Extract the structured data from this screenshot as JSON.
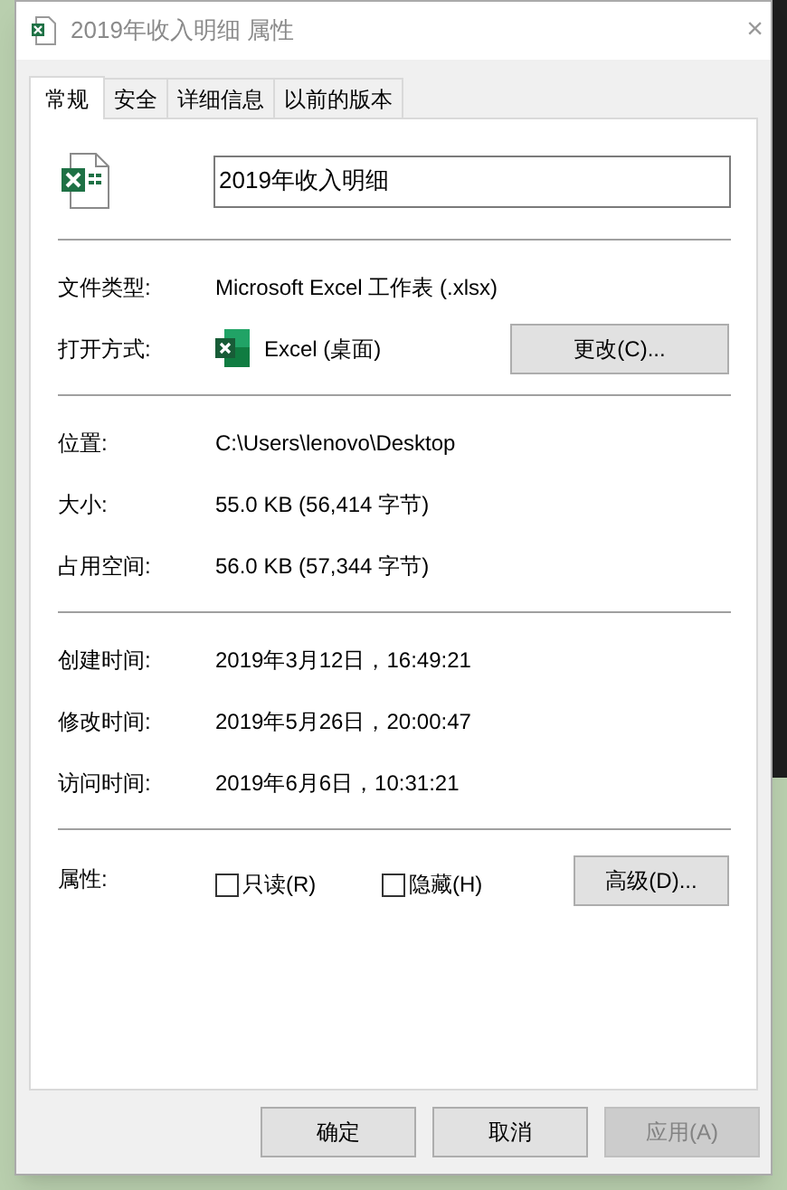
{
  "window": {
    "title": "2019年收入明细 属性",
    "close": "×"
  },
  "tabs": [
    {
      "label": "常规",
      "selected": true
    },
    {
      "label": "安全",
      "selected": false
    },
    {
      "label": "详细信息",
      "selected": false
    },
    {
      "label": "以前的版本",
      "selected": false
    }
  ],
  "file_name": {
    "value": "2019年收入明细"
  },
  "sections": [
    {
      "rows": [
        {
          "kind": "text",
          "label": "文件类型:",
          "value": "Microsoft Excel 工作表 (.xlsx)"
        },
        {
          "kind": "app",
          "label": "打开方式:",
          "value": "Excel (桌面)",
          "button": "更改(C)..."
        }
      ]
    },
    {
      "rows": [
        {
          "kind": "text",
          "label": "位置:",
          "value": "C:\\Users\\lenovo\\Desktop"
        },
        {
          "kind": "text",
          "label": "大小:",
          "value": "55.0 KB (56,414 字节)"
        },
        {
          "kind": "text",
          "label": "占用空间:",
          "value": "56.0 KB (57,344 字节)"
        }
      ]
    },
    {
      "rows": [
        {
          "kind": "text",
          "label": "创建时间:",
          "value": "2019年3月12日，16:49:21"
        },
        {
          "kind": "text",
          "label": "修改时间:",
          "value": "2019年5月26日，20:00:47"
        },
        {
          "kind": "text",
          "label": "访问时间:",
          "value": "2019年6月6日，10:31:21"
        }
      ]
    }
  ],
  "attributes": {
    "label": "属性:",
    "checkboxes": [
      {
        "label": "只读(R)",
        "checked": false
      },
      {
        "label": "隐藏(H)",
        "checked": false
      }
    ],
    "button": "高级(D)..."
  },
  "footer_buttons": [
    {
      "label": "确定",
      "disabled": false
    },
    {
      "label": "取消",
      "disabled": false
    },
    {
      "label": "应用(A)",
      "disabled": true
    }
  ]
}
